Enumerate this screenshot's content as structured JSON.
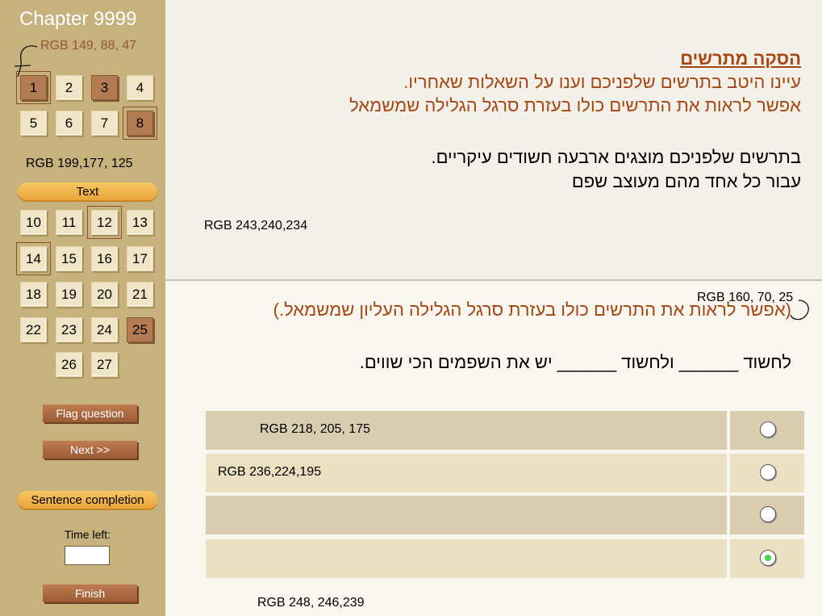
{
  "sidebar": {
    "chapter_title": "Chapter 9999",
    "color_note_top": "RGB 149, 88, 47",
    "color_note_mid": "RGB 199,177, 125",
    "group1": [
      {
        "label": "1",
        "state": "flagged-visited"
      },
      {
        "label": "2",
        "state": "normal"
      },
      {
        "label": "3",
        "state": "visited"
      },
      {
        "label": "4",
        "state": "normal"
      },
      {
        "label": "5",
        "state": "normal"
      },
      {
        "label": "6",
        "state": "normal"
      },
      {
        "label": "7",
        "state": "normal"
      },
      {
        "label": "8",
        "state": "flagged-visited"
      }
    ],
    "section_text_label": "Text",
    "group2": [
      {
        "label": "10",
        "state": "normal"
      },
      {
        "label": "11",
        "state": "normal"
      },
      {
        "label": "12",
        "state": "flagged"
      },
      {
        "label": "13",
        "state": "normal"
      },
      {
        "label": "14",
        "state": "flagged"
      },
      {
        "label": "15",
        "state": "normal"
      },
      {
        "label": "16",
        "state": "normal"
      },
      {
        "label": "17",
        "state": "normal"
      },
      {
        "label": "18",
        "state": "normal"
      },
      {
        "label": "19",
        "state": "normal"
      },
      {
        "label": "20",
        "state": "normal"
      },
      {
        "label": "21",
        "state": "normal"
      },
      {
        "label": "22",
        "state": "normal"
      },
      {
        "label": "23",
        "state": "normal"
      },
      {
        "label": "24",
        "state": "normal"
      },
      {
        "label": "25",
        "state": "visited"
      },
      {
        "label": "26",
        "state": "normal"
      },
      {
        "label": "27",
        "state": "normal"
      }
    ],
    "flag_button": "Flag question",
    "next_button": "Next >>",
    "section_sentence_label": "Sentence completion",
    "time_left_label": "Time left:",
    "time_left_value": "",
    "finish_button": "Finish"
  },
  "content": {
    "heading": "הסקה מתרשים",
    "instruction_1": "עיינו היטב בתרשים שלפניכם וענו על השאלות שאחריו.",
    "instruction_2": "אפשר לראות את התרשים כולו בעזרת סרגל הגלילה שמשמאל",
    "paragraph_1": "בתרשים שלפניכם מוצגים ארבעה חשודים עיקריים.",
    "paragraph_2": "עבור כל אחד מהם מעוצב שפם",
    "top_color_note": "RGB 243,240,234"
  },
  "question": {
    "color_note": "RGB 160, 70, 25",
    "note": "(אפשר לראות את התרשים כולו בעזרת סרגל הגלילה העליון שמשמאל.)",
    "text": "לחשוד ______ ולחשוד ______ יש את השפמים הכי שווים.",
    "options": [
      {
        "text": "RGB 218, 205, 175",
        "selected": false
      },
      {
        "text": "RGB 236,224,195",
        "selected": false
      },
      {
        "text": "",
        "selected": false
      },
      {
        "text": "",
        "selected": true
      }
    ],
    "bottom_color_note": "RGB 248, 246,239"
  },
  "colors": {
    "sidebar_bg": "#c7b17d",
    "top_bg": "#f3f0ea",
    "page_bg": "#f8f6ef",
    "accent_text": "#a64610",
    "row_dark": "#dacdaf",
    "row_light": "#ece0c3",
    "button_brown": "#95582f",
    "pill_orange": "#f0b04a",
    "selected_dot": "#3fd64a"
  }
}
